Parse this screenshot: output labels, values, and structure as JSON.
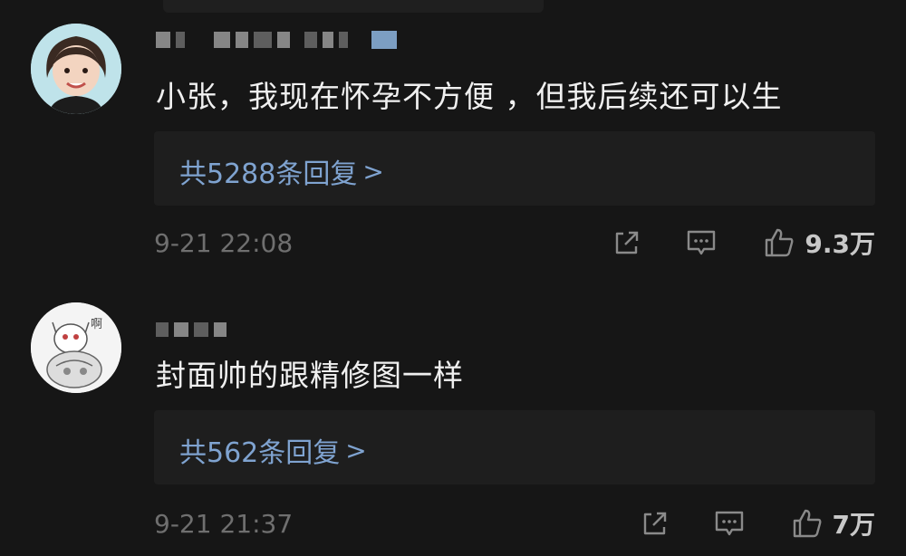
{
  "comments": [
    {
      "content": "小张，我现在怀孕不方便 ，但我后续还可以生",
      "replies_label": "共5288条回复",
      "time": "9-21 22:08",
      "likes": "9.3万"
    },
    {
      "content": "封面帅的跟精修图一样",
      "replies_label": "共562条回复",
      "time": "9-21 21:37",
      "likes": "7万"
    }
  ],
  "icons": {
    "share": "share-icon",
    "reply": "comment-icon",
    "like": "thumbs-up-icon",
    "chevron": "chevron-right-icon"
  },
  "colors": {
    "background": "#161616",
    "reply_box": "#1e1e1e",
    "link_blue": "#7fa3d0",
    "meta_gray": "#6f6f6f"
  }
}
